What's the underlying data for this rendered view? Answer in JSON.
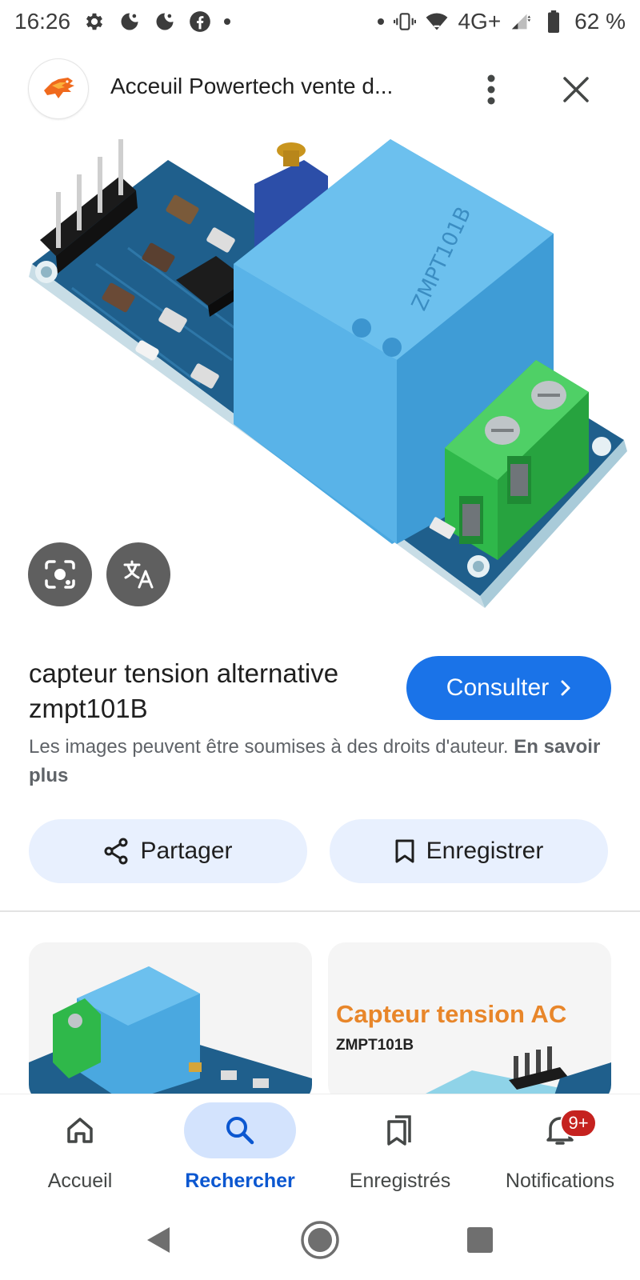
{
  "status_bar": {
    "time": "16:26",
    "network": "4G+",
    "battery": "62 %",
    "left_icons": [
      "settings-icon",
      "do-not-disturb-icon",
      "do-not-disturb-icon",
      "facebook-icon"
    ],
    "right_icons": [
      "vibrate-icon",
      "wifi-icon",
      "signal-icon",
      "battery-icon"
    ]
  },
  "top_bar": {
    "site_title": "Acceuil Powertech vente d...",
    "more_icon": "more-vert-icon",
    "close_icon": "close-icon"
  },
  "image_actions": {
    "lens_icon": "lens-icon",
    "translate_icon": "translate-icon"
  },
  "result": {
    "title": "capteur tension alternative zmpt101B",
    "visit_label": "Consulter",
    "copyright_text": "Les images peuvent être soumises à des droits d'auteur.",
    "learn_more": "En savoir plus"
  },
  "actions": {
    "share_label": "Partager",
    "save_label": "Enregistrer"
  },
  "related": [
    {
      "title": "",
      "subtitle": ""
    },
    {
      "title": "Capteur tension AC",
      "subtitle": "ZMPT101B"
    }
  ],
  "bottom_nav": {
    "items": [
      {
        "label": "Accueil",
        "icon": "home-icon",
        "active": false
      },
      {
        "label": "Rechercher",
        "icon": "search-icon",
        "active": true
      },
      {
        "label": "Enregistrés",
        "icon": "saved-collections-icon",
        "active": false
      },
      {
        "label": "Notifications",
        "icon": "bell-icon",
        "active": false
      }
    ],
    "notification_badge": "9+"
  },
  "colors": {
    "accent": "#1a73e8",
    "chip_bg": "#e8f0fe",
    "nav_active_bg": "#d3e3fd",
    "badge": "#c5221f",
    "module_blue": "#4aa8e0",
    "pcb_blue": "#1e5a86",
    "terminal_green": "#2fb84a"
  }
}
